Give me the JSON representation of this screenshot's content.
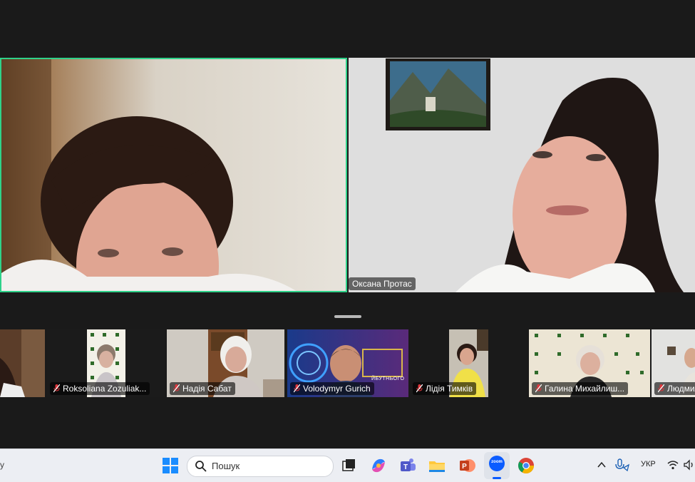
{
  "meeting": {
    "speaker": {
      "name": ""
    },
    "main_participant": {
      "name": "Оксана Протас"
    },
    "participants": [
      {
        "name": "",
        "muted": false
      },
      {
        "name": "Roksoliana Zozuliak...",
        "muted": true
      },
      {
        "name": "Надія Сабат",
        "muted": true
      },
      {
        "name": "Volodymyr Gurich",
        "muted": true
      },
      {
        "name": "Лідія Тимків",
        "muted": true
      },
      {
        "name": "Галина Михайлиш...",
        "muted": true
      },
      {
        "name": "Людмил",
        "muted": true
      }
    ],
    "thumbnail_banner_text": "ЙБУТНЬОГО"
  },
  "taskbar": {
    "search_placeholder": "Пошук",
    "zoom_label": "zoom",
    "language": "УКР",
    "left_edge_text": "у"
  },
  "colors": {
    "active_speaker_border": "#2fd28a",
    "muted_red": "#e0353b",
    "taskbar_bg": "#eceef3"
  }
}
